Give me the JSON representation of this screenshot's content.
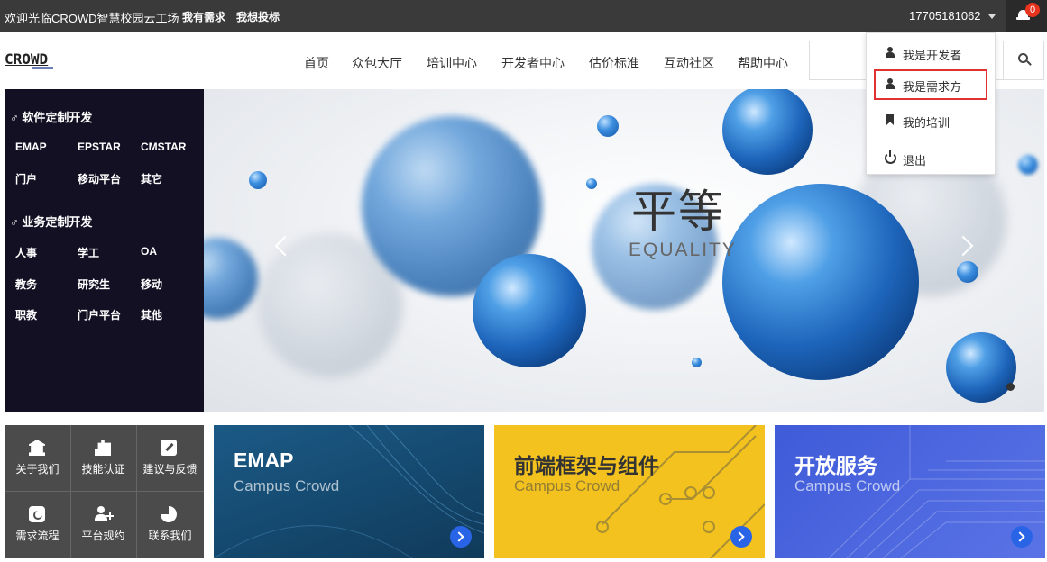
{
  "topbar": {
    "welcome": "欢迎光临CROWD智慧校园云工场",
    "link_need": "我有需求",
    "link_bid": "我想投标",
    "phone": "17705181062",
    "notification_count": "0"
  },
  "header": {
    "logo": "CROWD",
    "nav": [
      "首页",
      "众包大厅",
      "培训中心",
      "开发者中心",
      "估价标准",
      "互动社区",
      "帮助中心"
    ],
    "search_placeholder": ""
  },
  "dropdown": {
    "items": [
      {
        "label": "我是开发者",
        "icon": "user-icon"
      },
      {
        "label": "我是需求方",
        "icon": "user-icon"
      },
      {
        "label": "我的培训",
        "icon": "bookmark-icon"
      },
      {
        "label": "退出",
        "icon": "power-icon"
      }
    ],
    "active_index": 1,
    "active_border_color": "#e03232"
  },
  "categories": {
    "software": {
      "title": "♂ 软件定制开发",
      "links": [
        "EMAP",
        "EPSTAR",
        "CMSTAR",
        "门户",
        "移动平台",
        "其它"
      ]
    },
    "business": {
      "title": "♂ 业务定制开发",
      "links": [
        "人事",
        "学工",
        "OA",
        "教务",
        "研究生",
        "移动",
        "职教",
        "门户平台",
        "其他"
      ]
    }
  },
  "banner": {
    "title": "平等",
    "subtitle": "EQUALITY"
  },
  "quick_links": [
    {
      "label": "关于我们",
      "icon": "bank-icon"
    },
    {
      "label": "技能认证",
      "icon": "puzzle-icon"
    },
    {
      "label": "建议与反馈",
      "icon": "edit-icon"
    },
    {
      "label": "需求流程",
      "icon": "phone-icon"
    },
    {
      "label": "平台规约",
      "icon": "user-add-icon"
    },
    {
      "label": "联系我们",
      "icon": "pie-chart-icon"
    }
  ],
  "cards": [
    {
      "title": "EMAP",
      "subtitle": "Campus Crowd",
      "color": "#1b5a86"
    },
    {
      "title": "前端框架与组件",
      "subtitle": "Campus Crowd",
      "color": "#f3c21e"
    },
    {
      "title": "开放服务",
      "subtitle": "Campus Crowd",
      "color": "#4a64de"
    }
  ]
}
